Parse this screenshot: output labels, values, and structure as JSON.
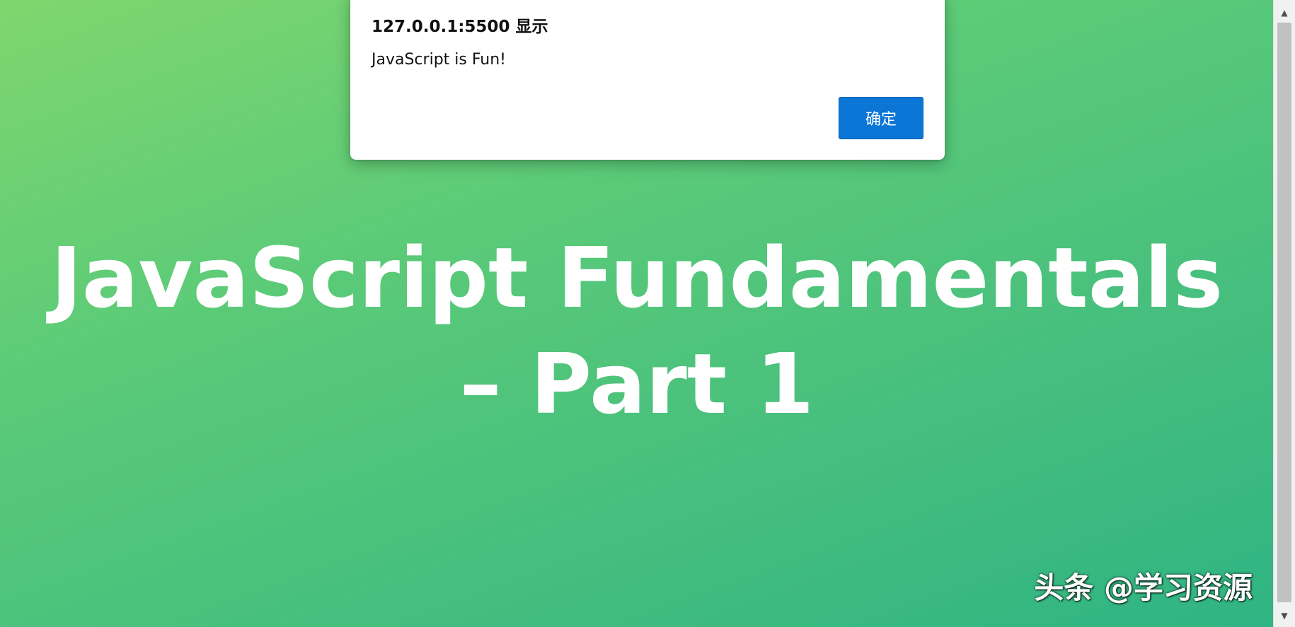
{
  "page": {
    "heading": "JavaScript Fundamentals – Part 1",
    "background_colors": [
      "#7fd66e",
      "#2fb483"
    ]
  },
  "alert_dialog": {
    "title": "127.0.0.1:5500 显示",
    "message": "JavaScript is Fun!",
    "ok_label": "确定",
    "button_color": "#0b76d6"
  },
  "scrollbar": {
    "up_icon": "▲",
    "down_icon": "▼"
  },
  "watermark": {
    "text": "头条 @学习资源"
  }
}
